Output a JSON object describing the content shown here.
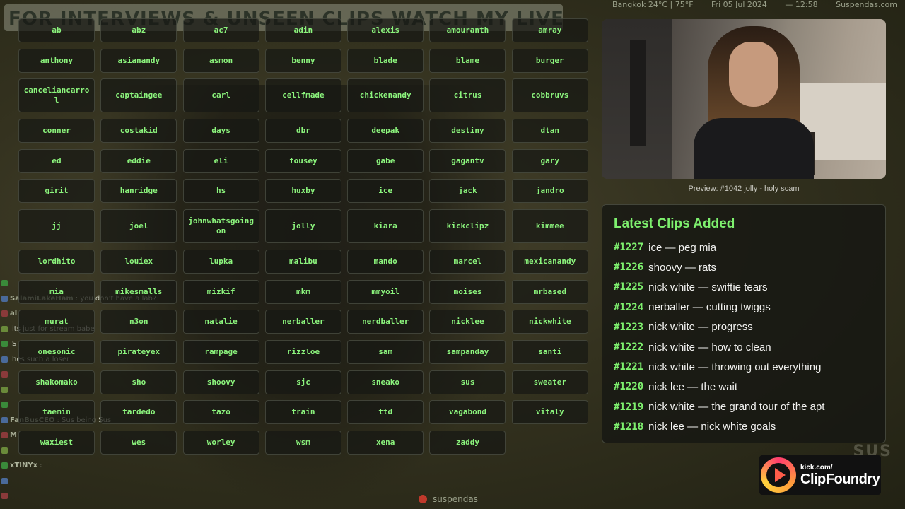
{
  "stream": {
    "banner": "FOR INTERVIEWS & UNSEEN CLIPS WATCH MY LIVE EVERYDAY",
    "top_overlay": [
      "Bangkok 24°C | 75°F",
      "Fri 05 Jul 2024",
      "— 12:58",
      "Suspendas.com"
    ],
    "watermark": "SUS",
    "footer_channel": "suspendas",
    "chat": [
      {
        "user": "",
        "msg": ""
      },
      {
        "user": "SalamiLakeHam",
        "msg": ": you don't have a lab?"
      },
      {
        "user": "al",
        "msg": ""
      },
      {
        "user": "",
        "msg": "its just for stream babe"
      },
      {
        "user": "",
        "msg": "S"
      },
      {
        "user": "",
        "msg": "hes such a loser"
      },
      {
        "user": "",
        "msg": ""
      },
      {
        "user": "",
        "msg": ""
      },
      {
        "user": "",
        "msg": ""
      },
      {
        "user": "FanBusCEO",
        "msg": ": Sus being Sus"
      },
      {
        "user": "M",
        "msg": ""
      },
      {
        "user": "",
        "msg": ""
      },
      {
        "user": "xTINYx",
        "msg": ":"
      },
      {
        "user": "",
        "msg": ""
      },
      {
        "user": "",
        "msg": ""
      }
    ]
  },
  "names": [
    "ab",
    "abz",
    "ac7",
    "adin",
    "alexis",
    "amouranth",
    "amray",
    "anthony",
    "asianandy",
    "asmon",
    "benny",
    "blade",
    "blame",
    "burger",
    "canceliancarrol",
    "captaingee",
    "carl",
    "cellfmade",
    "chickenandy",
    "citrus",
    "cobbruvs",
    "conner",
    "costakid",
    "days",
    "dbr",
    "deepak",
    "destiny",
    "dtan",
    "ed",
    "eddie",
    "eli",
    "fousey",
    "gabe",
    "gagantv",
    "gary",
    "girit",
    "hanridge",
    "hs",
    "huxby",
    "ice",
    "jack",
    "jandro",
    "jj",
    "joel",
    "johnwhatsgoingon",
    "jolly",
    "kiara",
    "kickclipz",
    "kimmee",
    "lordhito",
    "louiex",
    "lupka",
    "malibu",
    "mando",
    "marcel",
    "mexicanandy",
    "mia",
    "mikesmalls",
    "mizkif",
    "mkm",
    "mmyoil",
    "moises",
    "mrbased",
    "murat",
    "n3on",
    "natalie",
    "nerballer",
    "nerdballer",
    "nicklee",
    "nickwhite",
    "onesonic",
    "pirateyex",
    "rampage",
    "rizzloe",
    "sam",
    "sampanday",
    "santi",
    "shakomako",
    "sho",
    "shoovy",
    "sjc",
    "sneako",
    "sus",
    "sweater",
    "taemin",
    "tardedo",
    "tazo",
    "train",
    "ttd",
    "vagabond",
    "vitaly",
    "waxiest",
    "wes",
    "worley",
    "wsm",
    "xena",
    "zaddy"
  ],
  "preview": {
    "caption": "Preview: #1042 jolly - holy scam"
  },
  "latest": {
    "title": "Latest Clips Added",
    "clips": [
      {
        "num": "#1227",
        "text": "ice — peg mia"
      },
      {
        "num": "#1226",
        "text": "shoovy — rats"
      },
      {
        "num": "#1225",
        "text": "nick white — swiftie tears"
      },
      {
        "num": "#1224",
        "text": "nerballer — cutting twiggs"
      },
      {
        "num": "#1223",
        "text": "nick white — progress"
      },
      {
        "num": "#1222",
        "text": "nick white — how to clean"
      },
      {
        "num": "#1221",
        "text": "nick white — throwing out everything"
      },
      {
        "num": "#1220",
        "text": "nick lee — the wait"
      },
      {
        "num": "#1219",
        "text": "nick white — the grand tour of the apt"
      },
      {
        "num": "#1218",
        "text": "nick lee — nick white goals"
      }
    ]
  },
  "logo": {
    "small": "kick.com/",
    "big": "ClipFoundry"
  },
  "colors": {
    "accent_green": "#7ef06e",
    "name_green": "#8cf57d",
    "panel_bg": "#141612"
  }
}
